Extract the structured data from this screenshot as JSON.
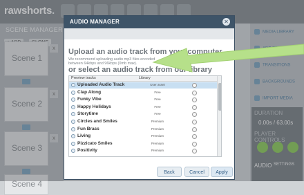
{
  "app": {
    "logo_text": "rawshorts",
    "logo_dot": "."
  },
  "scene_manager": {
    "title": "SCENE MANAGER",
    "add_label": "+ ADD",
    "clone_label": "CLONE",
    "scenes": [
      "Scene 1",
      "Scene 2",
      "Scene 3",
      "Scene 4"
    ]
  },
  "right_panel": {
    "items": [
      "MEDIA LIBRARY",
      "ADD TEXT",
      "TRANSITIONS",
      "BACKGROUNDS",
      "IMPORT MEDIA"
    ]
  },
  "duration": {
    "title": "DURATION",
    "value": "0.00s / 63.00s",
    "player_title": "PLAYER CONTROLS",
    "audio_label": "AUDIO",
    "settings_label": "SETTINGS"
  },
  "modal": {
    "title": "AUDIO MANAGER",
    "close_symbol": "✕",
    "upload_title": "Upload an audio track from your computer",
    "upload_note_1": "We recommend uploading audio mp3 files encoded",
    "upload_note_2": "between 64kbps and 96kbps (0mb max).",
    "library_title": "or select an audio track from our library",
    "col_tracks": "Preview tracks",
    "col_library": "Library",
    "tracks": [
      {
        "name": "Uploaded Audio Track",
        "library": "User asset"
      },
      {
        "name": "Clap Along",
        "library": "Free"
      },
      {
        "name": "Funky Vibe",
        "library": "Free"
      },
      {
        "name": "Happy Holidays",
        "library": "Free"
      },
      {
        "name": "Storytime",
        "library": "Free"
      },
      {
        "name": "Circles and Smiles",
        "library": "Premium"
      },
      {
        "name": "Fun Brass",
        "library": "Premium"
      },
      {
        "name": "Living",
        "library": "Premium"
      },
      {
        "name": "Pizzicato Smiles",
        "library": "Premium"
      },
      {
        "name": "Positivity",
        "library": "Premium"
      }
    ],
    "back_label": "Back",
    "cancel_label": "Cancel",
    "apply_label": "Apply"
  },
  "colors": {
    "accent": "#3e5468",
    "highlight": "#c8dff2",
    "arrow": "#b6e08a",
    "play": "#8fcf5c"
  }
}
